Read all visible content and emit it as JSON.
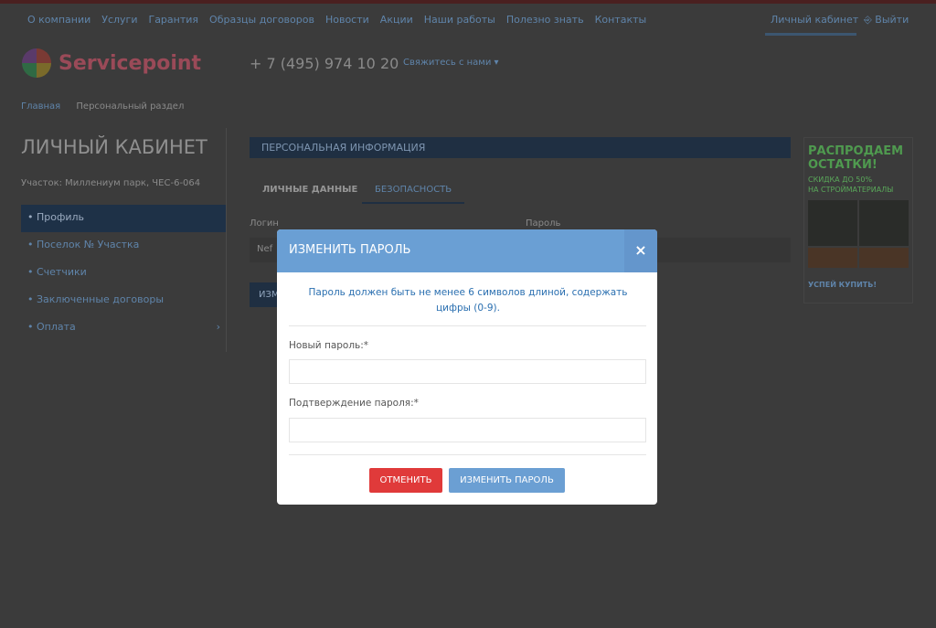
{
  "nav": {
    "items": [
      "О компании",
      "Услуги",
      "Гарантия",
      "Образцы договоров",
      "Новости",
      "Акции",
      "Наши работы",
      "Полезно знать",
      "Контакты"
    ],
    "account": "Личный кабинет",
    "logout": "Выйти"
  },
  "header": {
    "logo": "Servicepoint",
    "phone": "+ 7 (495) 974 10 20",
    "contact": "Свяжитесь с нами ▾"
  },
  "breadcrumb": [
    "Главная",
    "Персональный раздел"
  ],
  "sidebar": {
    "title": "ЛИЧНЫЙ КАБИНЕТ",
    "plot": "Участок: Миллениум парк, ЧЕС-6-064",
    "items": [
      {
        "label": "• Профиль",
        "active": true
      },
      {
        "label": "• Поселок № Участка"
      },
      {
        "label": "• Счетчики"
      },
      {
        "label": "• Заключенные договоры"
      },
      {
        "label": "• Оплата",
        "arrow": "›"
      }
    ]
  },
  "main": {
    "section": "ПЕРСОНАЛЬНАЯ ИНФОРМАЦИЯ",
    "tabs": [
      "ЛИЧНЫЕ ДАННЫЕ",
      "БЕЗОПАСНОСТЬ"
    ],
    "active_tab": "БЕЗОПАСНОСТЬ",
    "login_label": "Логин",
    "login_value": "Nef",
    "password_label": "Пароль",
    "change_button": "ИЗМЕНИТЬ ПАРОЛЬ"
  },
  "ad": {
    "headline": "РАСПРОДАЕМ ОСТАТКИ!",
    "sub1": "СКИДКА ДО 50%",
    "sub2": "НА СТРОЙМАТЕРИАЛЫ",
    "cta": "УСПЕЙ КУПИТЬ!"
  },
  "modal": {
    "title": "ИЗМЕНИТЬ ПАРОЛЬ",
    "close": "×",
    "note": "Пароль должен быть не менее 6 символов длиной, содержать цифры (0-9).",
    "new_label": "Новый пароль:*",
    "new_value": "",
    "confirm_label": "Подтверждение пароля:*",
    "confirm_value": "",
    "cancel": "ОТМЕНИТЬ",
    "submit": "ИЗМЕНИТЬ ПАРОЛЬ"
  },
  "colors": {
    "modal_header": "#6a9fd4",
    "cancel": "#e03a3a",
    "submit": "#6b9fd3",
    "brand_blue": "#2a5d99"
  }
}
